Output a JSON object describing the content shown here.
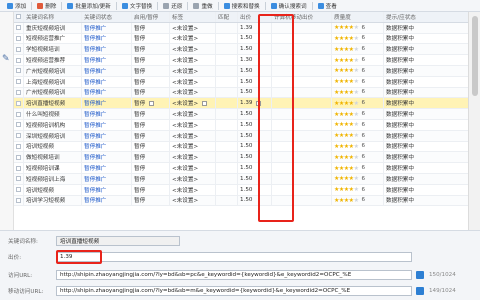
{
  "toolbar": {
    "items": [
      {
        "label": "添加",
        "icon": "add-icon",
        "color": "#3b8de0"
      },
      {
        "label": "删除",
        "icon": "delete-icon",
        "color": "#e05a3b"
      },
      {
        "label": "批量添加/更新",
        "icon": "batch-icon",
        "color": "#3b8de0"
      },
      {
        "label": "文字替换",
        "icon": "replace-icon",
        "color": "#3b8de0"
      },
      {
        "label": "还原",
        "icon": "undo-icon",
        "color": "#9aa4b0"
      },
      {
        "label": "重做",
        "icon": "redo-icon",
        "color": "#9aa4b0"
      },
      {
        "label": "搜索和替换",
        "icon": "search-icon",
        "color": "#3b8de0"
      },
      {
        "label": "确认搜索词",
        "icon": "confirm-icon",
        "color": "#3b8de0"
      },
      {
        "label": "查看",
        "icon": "view-icon",
        "color": "#3b8de0"
      }
    ]
  },
  "grid": {
    "headers": [
      "",
      "关键词名称",
      "关键词状态",
      "启用/暂停",
      "标签",
      "匹配",
      "出价",
      "计算机移动出价",
      "质量度",
      "提示/应状态"
    ],
    "rows": [
      {
        "kw": "重庆短视频培训",
        "status": "暂停推广",
        "onoff": "暂停",
        "tag": "<未设置>",
        "match": "",
        "bid": "1.39",
        "calc": "",
        "stars": 4,
        "q": "6",
        "fb": "数据积累中",
        "sel": false
      },
      {
        "kw": "短视频运营推广",
        "status": "暂停推广",
        "onoff": "暂停",
        "tag": "<未设置>",
        "match": "",
        "bid": "1.50",
        "calc": "",
        "stars": 4,
        "q": "6",
        "fb": "数据积累中",
        "sel": false
      },
      {
        "kw": "学短视频培训",
        "status": "暂停推广",
        "onoff": "暂停",
        "tag": "<未设置>",
        "match": "",
        "bid": "1.50",
        "calc": "",
        "stars": 4,
        "q": "6",
        "fb": "数据积累中",
        "sel": false
      },
      {
        "kw": "短视频运营推荐",
        "status": "暂停推广",
        "onoff": "暂停",
        "tag": "<未设置>",
        "match": "",
        "bid": "1.30",
        "calc": "",
        "stars": 4,
        "q": "6",
        "fb": "数据积累中",
        "sel": false
      },
      {
        "kw": "广州短视频培训",
        "status": "暂停推广",
        "onoff": "暂停",
        "tag": "<未设置>",
        "match": "",
        "bid": "1.50",
        "calc": "",
        "stars": 4,
        "q": "6",
        "fb": "数据积累中",
        "sel": false
      },
      {
        "kw": "上海短视频培训",
        "status": "暂停推广",
        "onoff": "暂停",
        "tag": "<未设置>",
        "match": "",
        "bid": "1.50",
        "calc": "",
        "stars": 4,
        "q": "6",
        "fb": "数据积累中",
        "sel": false
      },
      {
        "kw": "广州短视频培训",
        "status": "暂停推广",
        "onoff": "暂停",
        "tag": "<未设置>",
        "match": "",
        "bid": "1.50",
        "calc": "",
        "stars": 4,
        "q": "6",
        "fb": "数据积累中",
        "sel": false
      },
      {
        "kw": "培训直播短视频",
        "status": "暂停推广",
        "onoff": "暂停",
        "tag": "<未设置>",
        "match": "",
        "bid": "1.39",
        "calc": "",
        "stars": 4,
        "q": "6",
        "fb": "数据积累中",
        "sel": true
      },
      {
        "kw": "什么叫短视频",
        "status": "暂停推广",
        "onoff": "暂停",
        "tag": "<未设置>",
        "match": "",
        "bid": "1.50",
        "calc": "",
        "stars": 4,
        "q": "6",
        "fb": "数据积累中",
        "sel": false
      },
      {
        "kw": "短视频培训机构",
        "status": "暂停推广",
        "onoff": "暂停",
        "tag": "<未设置>",
        "match": "",
        "bid": "1.50",
        "calc": "",
        "stars": 4,
        "q": "6",
        "fb": "数据积累中",
        "sel": false
      },
      {
        "kw": "深圳短视频培训",
        "status": "暂停推广",
        "onoff": "暂停",
        "tag": "<未设置>",
        "match": "",
        "bid": "1.50",
        "calc": "",
        "stars": 4,
        "q": "6",
        "fb": "数据积累中",
        "sel": false
      },
      {
        "kw": "培训短视频",
        "status": "暂停推广",
        "onoff": "暂停",
        "tag": "<未设置>",
        "match": "",
        "bid": "1.50",
        "calc": "",
        "stars": 4,
        "q": "6",
        "fb": "数据积累中",
        "sel": false
      },
      {
        "kw": "做短视频培训",
        "status": "暂停推广",
        "onoff": "暂停",
        "tag": "<未设置>",
        "match": "",
        "bid": "1.50",
        "calc": "",
        "stars": 4,
        "q": "6",
        "fb": "数据积累中",
        "sel": false
      },
      {
        "kw": "短视频培训课",
        "status": "暂停推广",
        "onoff": "暂停",
        "tag": "<未设置>",
        "match": "",
        "bid": "1.50",
        "calc": "",
        "stars": 4,
        "q": "6",
        "fb": "数据积累中",
        "sel": false
      },
      {
        "kw": "短视频培训上海",
        "status": "暂停推广",
        "onoff": "暂停",
        "tag": "<未设置>",
        "match": "",
        "bid": "1.50",
        "calc": "",
        "stars": 4,
        "q": "6",
        "fb": "数据积累中",
        "sel": false
      },
      {
        "kw": "培训短视频",
        "status": "暂停推广",
        "onoff": "暂停",
        "tag": "<未设置>",
        "match": "",
        "bid": "1.50",
        "calc": "",
        "stars": 4,
        "q": "6",
        "fb": "数据积累中",
        "sel": false
      },
      {
        "kw": "培训学习短视频",
        "status": "暂停推广",
        "onoff": "暂停",
        "tag": "<未设置>",
        "match": "",
        "bid": "1.50",
        "calc": "",
        "stars": 4,
        "q": "6",
        "fb": "数据积累中",
        "sel": false
      }
    ]
  },
  "form": {
    "keyword_label": "关键词名称:",
    "keyword_value": "培训直播短视频",
    "bid_label": "出价:",
    "bid_value": "1.39",
    "url_label": "访问URL:",
    "url_value": "http://shipin.zhaoyangjingjia.com/?ly=bd&sb=pc&e_keywordid={keywordid}&e_keywordid2=OCPC_%E",
    "url_counter": "150/1024",
    "murl_label": "移动访问URL:",
    "murl_value": "http://shipin.zhaoyangjingjia.com/?ly=bd&sb=m&e_keywordid={keywordid}&e_keywordid2=OCPC_%E",
    "murl_counter": "149/1024"
  },
  "colors": {
    "highlight": "#e8231a",
    "selected_row": "#fff3b5",
    "link_blue": "#1a56c8",
    "star": "#f0b400"
  }
}
